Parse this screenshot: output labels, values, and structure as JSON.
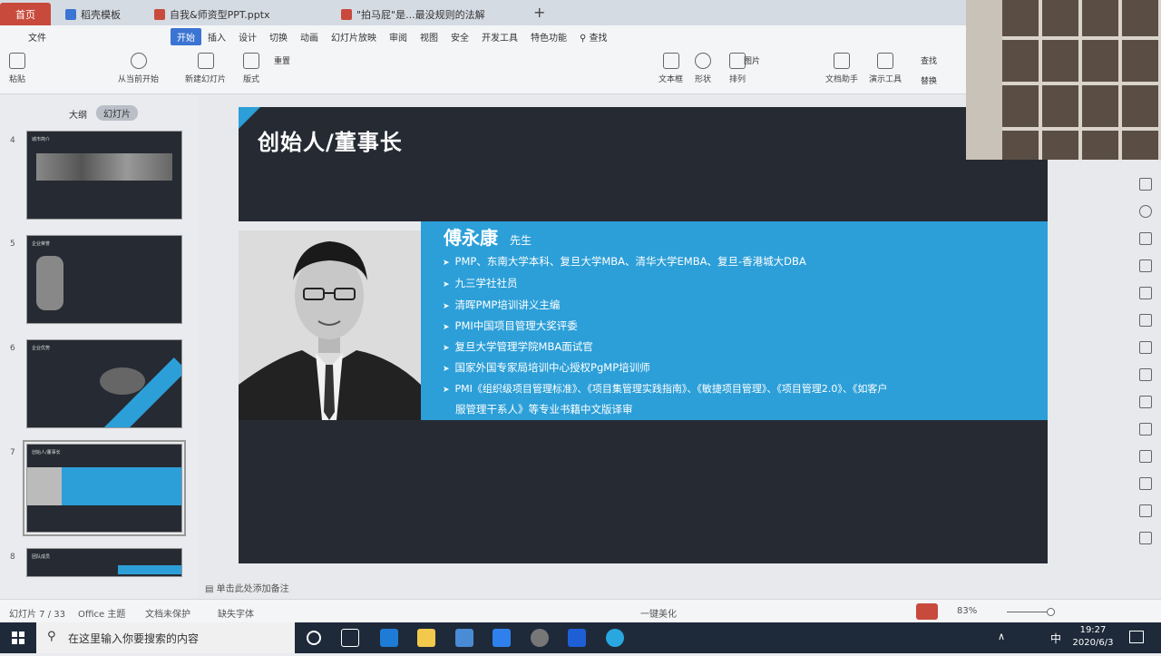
{
  "tabs": [
    {
      "label": "首页"
    },
    {
      "label": "稻壳模板"
    },
    {
      "label": "自我&师资型PPT.pptx"
    },
    {
      "label": "\"拍马屁\"是...最没规则的法解"
    }
  ],
  "new_tab_label": "+",
  "menu": {
    "file": "文件",
    "items": [
      "开始",
      "插入",
      "设计",
      "切换",
      "动画",
      "幻灯片放映",
      "审阅",
      "视图",
      "安全",
      "开发工具",
      "特色功能"
    ],
    "search": "查找"
  },
  "toolbar": {
    "paste": "粘贴",
    "from_current": "从当前开始",
    "new_slide": "新建幻灯片",
    "layout": "版式",
    "reset": "重置",
    "text_box": "文本框",
    "shape": "形状",
    "arrange": "排列",
    "picture": "图片",
    "doc_helper": "文档助手",
    "presentation_tool": "演示工具",
    "find": "查找",
    "replace": "替换"
  },
  "panel_tabs": {
    "outline": "大纲",
    "slides": "幻灯片"
  },
  "thumbnails": [
    {
      "num": "4",
      "title": "城市简介"
    },
    {
      "num": "5",
      "title": "企业荣誉"
    },
    {
      "num": "6",
      "title": "企业优势"
    },
    {
      "num": "7",
      "title": "创始人/董事长"
    },
    {
      "num": "8",
      "title": "团队成员"
    }
  ],
  "slide": {
    "title": "创始人/董事长",
    "name": "傅永康",
    "honorific": "先生",
    "bullets": [
      "PMP、东南大学本科、复旦大学MBA、清华大学EMBA、复旦-香港城大DBA",
      "九三学社社员",
      "清晖PMP培训讲义主编",
      "PMI中国项目管理大奖评委",
      "复旦大学管理学院MBA面试官",
      "国家外国专家局培训中心授权PgMP培训师",
      "PMI《组织级项目管理标准》、《项目集管理实践指南》、《敏捷项目管理》、《项目管理2.0》、《如客户",
      "服管理干系人》等专业书籍中文版译审"
    ]
  },
  "notes_placeholder": "单击此处添加备注",
  "status": {
    "slide_count": "幻灯片 7 / 33",
    "theme": "Office 主题",
    "doc_protect": "文档未保护",
    "missing_font": "缺失字体",
    "beautify": "一键美化",
    "zoom": "83%"
  },
  "taskbar": {
    "search_placeholder": "在这里输入你要搜索的内容",
    "time": "19:27",
    "date": "2020/6/3",
    "ime": "中"
  },
  "colors": {
    "accent": "#3c74d4",
    "slide_bg": "#262a33",
    "panel_blue": "#2c9fd8",
    "home_tab": "#c84a3c"
  }
}
